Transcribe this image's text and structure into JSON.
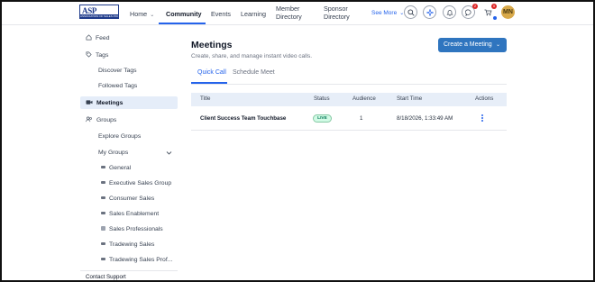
{
  "logo": {
    "brand": "ASP",
    "strip": "ASSOCIATION OF SALES PROFESSIONALS"
  },
  "nav": {
    "home": "Home",
    "community": "Community",
    "events": "Events",
    "learning": "Learning",
    "member_directory_1": "Member",
    "member_directory_2": "Directory",
    "sponsor_directory_1": "Sponsor",
    "sponsor_directory_2": "Directory",
    "see_more": "See More",
    "messages_badge": "2",
    "cart_badge": "0",
    "avatar_initials": "MN"
  },
  "sidebar": {
    "feed": "Feed",
    "tags": "Tags",
    "discover_tags": "Discover Tags",
    "followed_tags": "Followed Tags",
    "meetings": "Meetings",
    "groups": "Groups",
    "explore_groups": "Explore Groups",
    "my_groups": "My Groups",
    "group_items": [
      "General",
      "Executive Sales Group",
      "Consumer Sales",
      "Sales Enablement",
      "Sales Professionals",
      "Tradewing Sales",
      "Tradewing Sales Prof..."
    ],
    "contact_support": "Contact Support"
  },
  "main": {
    "title": "Meetings",
    "subtitle": "Create, share, and manage instant video calls.",
    "create_button": "Create a Meeting",
    "tabs": [
      "Quick Call",
      "Schedule Meet"
    ],
    "columns": [
      "Title",
      "Status",
      "Audience",
      "Start Time",
      "Actions"
    ],
    "rows": [
      {
        "title": "Client Success Team Touchbase",
        "status": "LIVE",
        "audience": "1",
        "start_time": "8/18/2026, 1:33:49 AM"
      }
    ]
  },
  "colors": {
    "accent": "#2563eb",
    "button": "#2f75bf",
    "live": "#047857",
    "badge": "#dc2626",
    "avatar": "#d8a94a"
  }
}
